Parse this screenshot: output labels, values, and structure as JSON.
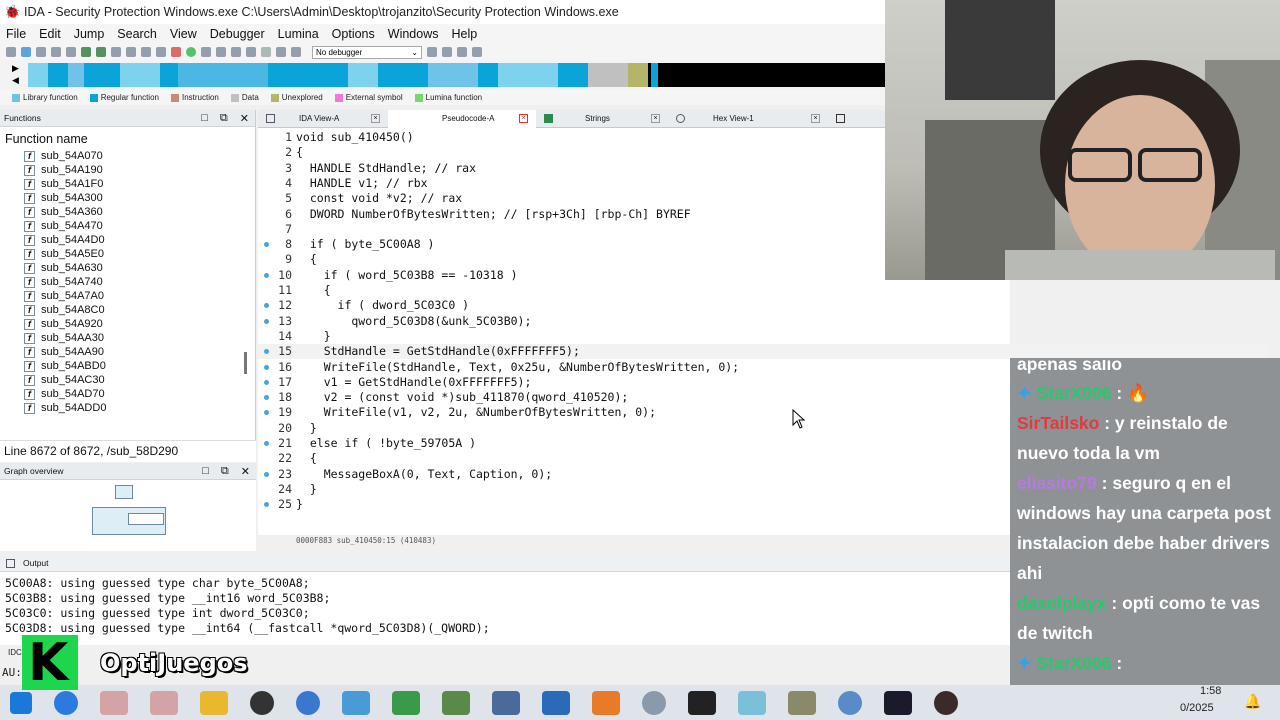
{
  "window": {
    "title": "IDA - Security Protection Windows.exe C:\\Users\\Admin\\Desktop\\trojanzito\\Security Protection Windows.exe"
  },
  "menu": [
    "File",
    "Edit",
    "Jump",
    "Search",
    "View",
    "Debugger",
    "Lumina",
    "Options",
    "Windows",
    "Help"
  ],
  "toolbar": {
    "debugger_select": "No debugger"
  },
  "legend": [
    {
      "label": "Library function",
      "color": "#6fc3e8"
    },
    {
      "label": "Regular function",
      "color": "#0aa4d8"
    },
    {
      "label": "Instruction",
      "color": "#c88a76"
    },
    {
      "label": "Data",
      "color": "#c0c0c0"
    },
    {
      "label": "Unexplored",
      "color": "#b5b56a"
    },
    {
      "label": "External symbol",
      "color": "#f07ad8"
    },
    {
      "label": "Lumina function",
      "color": "#7ad86a"
    }
  ],
  "functions_panel": {
    "title": "Functions",
    "column": "Function name",
    "items": [
      "sub_54A070",
      "sub_54A190",
      "sub_54A1F0",
      "sub_54A300",
      "sub_54A360",
      "sub_54A470",
      "sub_54A4D0",
      "sub_54A5E0",
      "sub_54A630",
      "sub_54A740",
      "sub_54A7A0",
      "sub_54A8C0",
      "sub_54A920",
      "sub_54AA30",
      "sub_54AA90",
      "sub_54ABD0",
      "sub_54AC30",
      "sub_54AD70",
      "sub_54ADD0"
    ]
  },
  "line_status": "Line 8672 of 8672, /sub_58D290",
  "graph_overview": {
    "title": "Graph overview"
  },
  "tabs": [
    {
      "label": "IDA View-A",
      "active": false
    },
    {
      "label": "Pseudocode-A",
      "active": true
    },
    {
      "label": "Strings",
      "active": false
    },
    {
      "label": "Hex View-1",
      "active": false
    }
  ],
  "pseudocode": [
    {
      "n": "1",
      "dot": false,
      "code": "void sub_410450()"
    },
    {
      "n": "2",
      "dot": false,
      "code": "{"
    },
    {
      "n": "3",
      "dot": false,
      "code": "  HANDLE StdHandle; // rax"
    },
    {
      "n": "4",
      "dot": false,
      "code": "  HANDLE v1; // rbx"
    },
    {
      "n": "5",
      "dot": false,
      "code": "  const void *v2; // rax"
    },
    {
      "n": "6",
      "dot": false,
      "code": "  DWORD NumberOfBytesWritten; // [rsp+3Ch] [rbp-Ch] BYREF"
    },
    {
      "n": "7",
      "dot": false,
      "code": ""
    },
    {
      "n": "8",
      "dot": true,
      "code": "  if ( byte_5C00A8 )"
    },
    {
      "n": "9",
      "dot": false,
      "code": "  {"
    },
    {
      "n": "10",
      "dot": true,
      "code": "    if ( word_5C03B8 == -10318 )"
    },
    {
      "n": "11",
      "dot": false,
      "code": "    {"
    },
    {
      "n": "12",
      "dot": true,
      "code": "      if ( dword_5C03C0 )"
    },
    {
      "n": "13",
      "dot": true,
      "code": "        qword_5C03D8(&unk_5C03B0);"
    },
    {
      "n": "14",
      "dot": false,
      "code": "    }"
    },
    {
      "n": "15",
      "dot": true,
      "code": "    StdHandle = GetStdHandle(0xFFFFFFF5);"
    },
    {
      "n": "16",
      "dot": true,
      "code": "    WriteFile(StdHandle, Text, 0x25u, &NumberOfBytesWritten, 0);"
    },
    {
      "n": "17",
      "dot": true,
      "code": "    v1 = GetStdHandle(0xFFFFFFF5);"
    },
    {
      "n": "18",
      "dot": true,
      "code": "    v2 = (const void *)sub_411870(qword_410520);"
    },
    {
      "n": "19",
      "dot": true,
      "code": "    WriteFile(v1, v2, 2u, &NumberOfBytesWritten, 0);"
    },
    {
      "n": "20",
      "dot": false,
      "code": "  }"
    },
    {
      "n": "21",
      "dot": true,
      "code": "  else if ( !byte_59705A )"
    },
    {
      "n": "22",
      "dot": false,
      "code": "  {"
    },
    {
      "n": "23",
      "dot": true,
      "code": "    MessageBoxA(0, Text, Caption, 0);"
    },
    {
      "n": "24",
      "dot": false,
      "code": "  }"
    },
    {
      "n": "25",
      "dot": true,
      "code": "}"
    }
  ],
  "address_bar": "0000F883 sub_410450:15 (410483)",
  "output": {
    "title": "Output",
    "lines": [
      "5C00A8: using guessed type char byte_5C00A8;",
      "5C03B8: using guessed type __int16 word_5C03B8;",
      "5C03C0: using guessed type int dword_5C03C0;",
      "5C03D8: using guessed type __int64 (__fastcall *qword_5C03D8)(_QWORD);"
    ],
    "prefix_idc": "IDC",
    "prefix_au": "AU:"
  },
  "chat": [
    {
      "user": "",
      "text": "apenas salio"
    },
    {
      "user": "StarX006",
      "text": "🔥"
    },
    {
      "user": "SirTailsko",
      "text": "y reinstalo de nuevo toda la vm"
    },
    {
      "user": "eliasito79",
      "text": "seguro q en el windows hay una carpeta post instalacion debe haber drivers ahi"
    },
    {
      "user": "daxelplayx",
      "text": "opti como te vas de twitch"
    },
    {
      "user": "StarX006",
      "text": ""
    }
  ],
  "brand": {
    "letter": "K",
    "name": "OptiJuegos"
  },
  "clock": {
    "time": "1:58",
    "date": "0/2025"
  }
}
